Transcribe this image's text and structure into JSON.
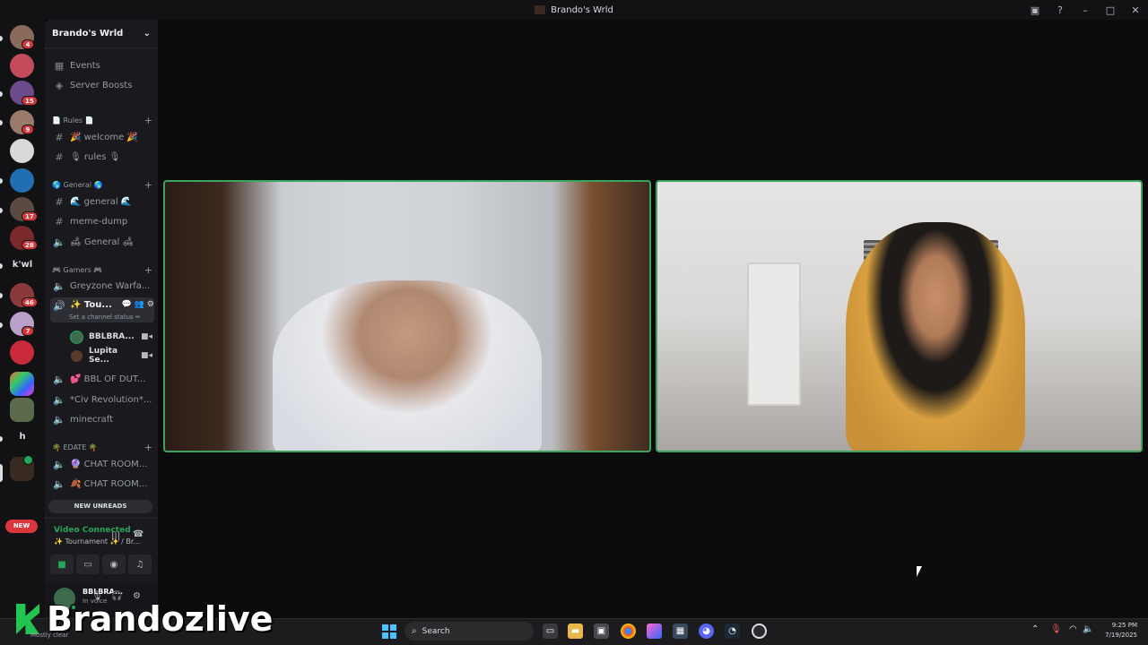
{
  "window": {
    "title": "Brando's Wrld"
  },
  "rail": {
    "badges": [
      "4",
      "15",
      "9",
      "17",
      "28",
      "46",
      "7"
    ],
    "text_servers": [
      "k'wl",
      "h"
    ],
    "new_label": "NEW"
  },
  "sidebar": {
    "server_name": "Brando's Wrld",
    "top_items": [
      "Events",
      "Server Boosts"
    ],
    "categories": [
      {
        "label": "📄 Rules 📄"
      },
      {
        "label": "🌎 General 🌎"
      },
      {
        "label": "🎮 Gamers 🎮"
      },
      {
        "label": "🌴 EDATE 🌴"
      }
    ],
    "channels": {
      "welcome": "🎉 welcome 🎉",
      "rules": "🎙 rules 🎙",
      "general_text": "🌊 general 🌊",
      "meme_dump": "meme-dump",
      "general_voice": "🛋 General 🛋",
      "greyzone": "Greyzone Warfa...",
      "tournament": "✨ Tou...",
      "bbl": "💕 BBL OF DUT...",
      "civ": "*Civ Revolution*...",
      "minecraft": "minecraft",
      "chat1": "🔮 CHAT ROOM...",
      "chat2": "🍂 CHAT ROOM..."
    },
    "status_placeholder": "Set a channel status ✏",
    "voice_users": [
      "BBLBRA...",
      "Lupita Se..."
    ],
    "new_unreads": "NEW UNREADS"
  },
  "voice_panel": {
    "title": "Video Connected",
    "subtitle": "✨ Tournament ✨ / Br..."
  },
  "user_panel": {
    "name": "BBLBRA...",
    "status": "In voice"
  },
  "watermark": {
    "text": "Brandozlive",
    "sub": "Mostly clear"
  },
  "taskbar": {
    "search_placeholder": "Search",
    "time": "9:25 PM",
    "date": "7/19/2025"
  },
  "colors": {
    "accent_green": "#23a55a",
    "tile_border": "#3ba55c",
    "badge_red": "#da373c"
  }
}
